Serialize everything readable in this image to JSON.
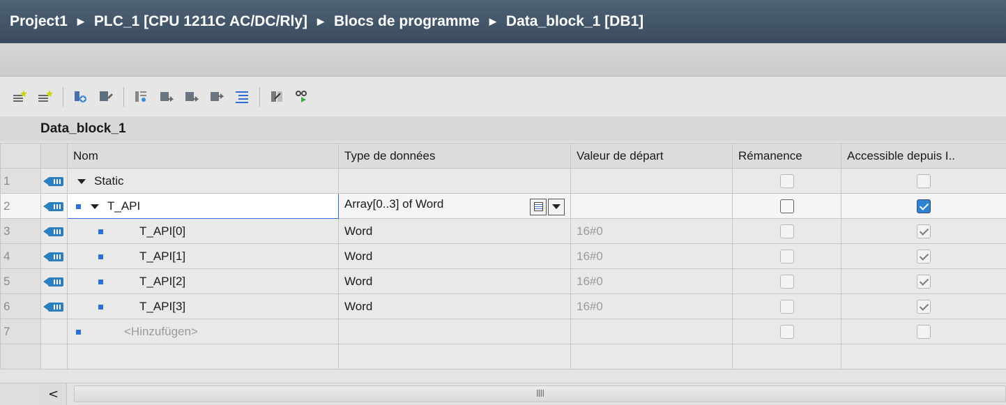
{
  "breadcrumb": [
    "Project1",
    "PLC_1 [CPU 1211C AC/DC/Rly]",
    "Blocs de programme",
    "Data_block_1 [DB1]"
  ],
  "block_name": "Data_block_1",
  "toolbar": {
    "icons": [
      "insert-row-icon",
      "add-row-icon",
      "expand-icon",
      "collapse-icon",
      "snapshot-icon",
      "copy-snapshot-icon",
      "load-snapshot-icon",
      "load-start-values-icon",
      "list-icon",
      "keep-actual-values-icon",
      "monitor-icon"
    ]
  },
  "columns": {
    "name": "Nom",
    "type": "Type de données",
    "start": "Valeur de départ",
    "retain": "Rémanence",
    "access": "Accessible depuis I.."
  },
  "rows": [
    {
      "num": "1",
      "name": "Static",
      "type": "",
      "start": "",
      "retain": false,
      "access": false
    },
    {
      "num": "2",
      "name": "T_API",
      "type": "Array[0..3] of Word",
      "start": "",
      "retain": false,
      "access": true
    },
    {
      "num": "3",
      "name": "T_API[0]",
      "type": "Word",
      "start": "16#0",
      "retain": false,
      "access": true
    },
    {
      "num": "4",
      "name": "T_API[1]",
      "type": "Word",
      "start": "16#0",
      "retain": false,
      "access": true
    },
    {
      "num": "5",
      "name": "T_API[2]",
      "type": "Word",
      "start": "16#0",
      "retain": false,
      "access": true
    },
    {
      "num": "6",
      "name": "T_API[3]",
      "type": "Word",
      "start": "16#0",
      "retain": false,
      "access": true
    },
    {
      "num": "7",
      "name": "<Hinzufügen>",
      "type": "",
      "start": "",
      "retain": false,
      "access": false
    }
  ],
  "scrollbar": {
    "left_arrow": "<",
    "grip": "IIII"
  }
}
